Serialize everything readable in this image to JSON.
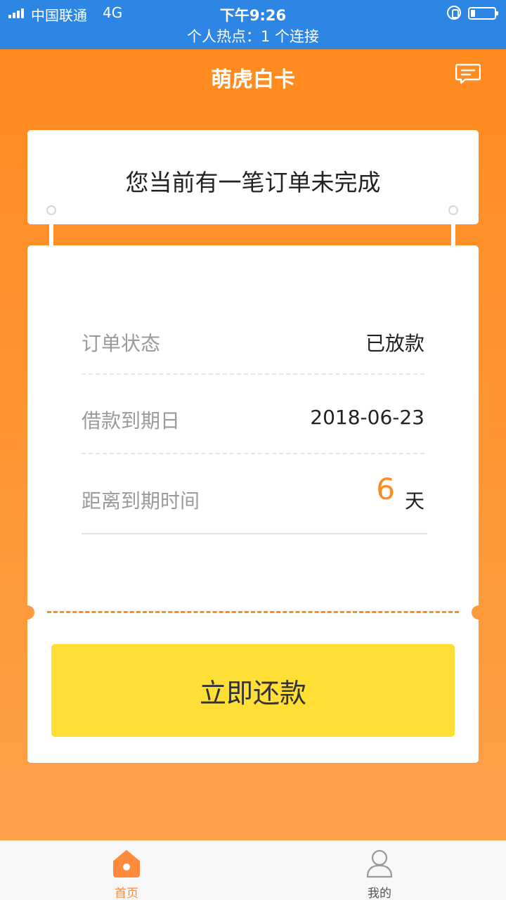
{
  "status_bar": {
    "carrier": "中国联通",
    "network": "4G",
    "time": "下午9:26",
    "hotspot": "个人热点：1 个连接"
  },
  "header": {
    "title": "萌虎白卡",
    "message_icon": "message-icon"
  },
  "order_notice": "您当前有一笔订单未完成",
  "order": {
    "status_label": "订单状态",
    "status_value": "已放款",
    "due_label": "借款到期日",
    "due_value": "2018-06-23",
    "remaining_label": "距离到期时间",
    "remaining_days": "6",
    "remaining_unit": "天"
  },
  "repay_button": "立即还款",
  "tabbar": {
    "items": [
      {
        "label": "首页",
        "icon": "home-icon",
        "active": true
      },
      {
        "label": "我的",
        "icon": "user-icon",
        "active": false
      }
    ]
  },
  "colors": {
    "status_bar": "#2d86e3",
    "accent": "#ff8a1f",
    "button": "#ffdf36"
  }
}
